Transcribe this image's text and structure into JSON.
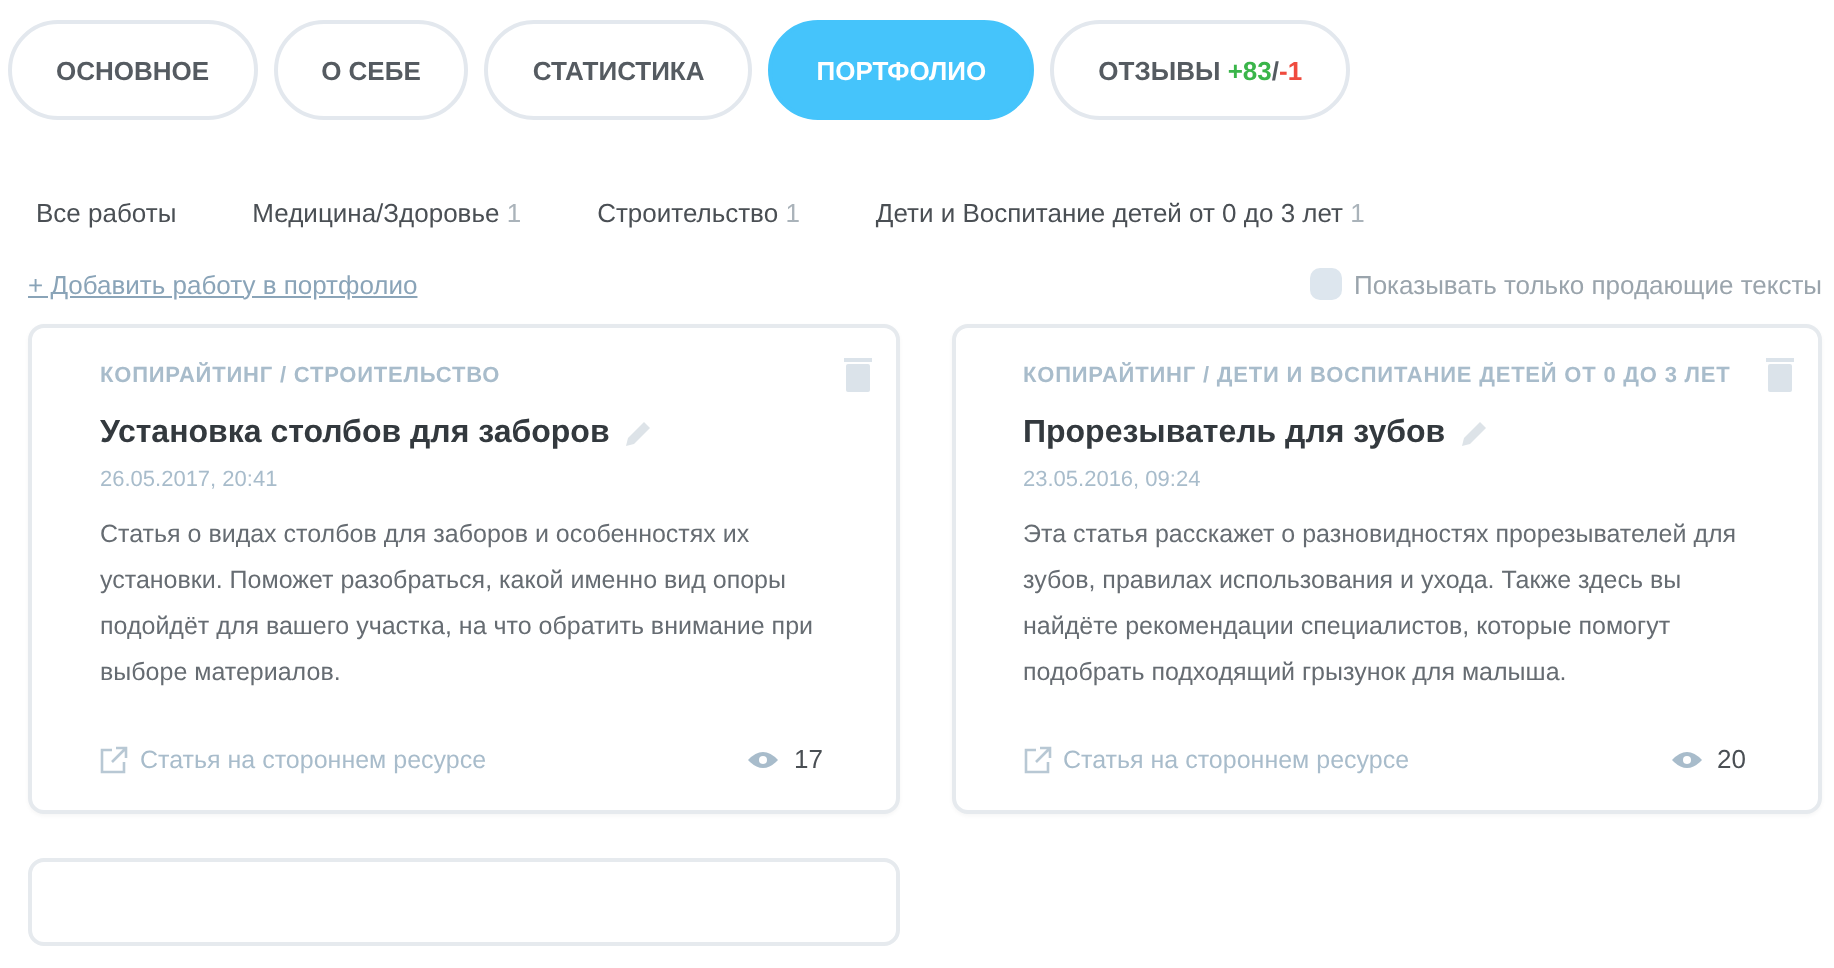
{
  "tabs": [
    {
      "label": "ОСНОВНОЕ",
      "selected": false
    },
    {
      "label": "О СЕБЕ",
      "selected": false
    },
    {
      "label": "СТАТИСТИКА",
      "selected": false
    },
    {
      "label": "ПОРТФОЛИО",
      "selected": true
    },
    {
      "label": "ОТЗЫВЫ",
      "selected": false,
      "positive": "+83",
      "slash": "/",
      "negative": "-1"
    }
  ],
  "filters": [
    {
      "label": "Все работы"
    },
    {
      "label": "Медицина/Здоровье",
      "count": "1"
    },
    {
      "label": "Строительство",
      "count": "1"
    },
    {
      "label": "Дети и Воспитание детей от 0 до 3 лет",
      "count": "1"
    }
  ],
  "add_link": "+ Добавить работу в портфолио",
  "selling_only": {
    "label": "Показывать только продающие тексты",
    "checked": false
  },
  "cards": [
    {
      "category": "КОПИРАЙТИНГ / СТРОИТЕЛЬСТВО",
      "title": "Установка столбов для заборов",
      "date": "26.05.2017, 20:41",
      "description": "Статья о видах столбов для заборов и особенностях их установки. Поможет разобраться, какой именно вид опоры подойдёт для вашего участка, на что обратить внимание при выборе материалов.",
      "source": "Статья на стороннем ресурсе",
      "views": "17"
    },
    {
      "category": "КОПИРАЙТИНГ / ДЕТИ И ВОСПИТАНИЕ ДЕТЕЙ ОТ 0 ДО 3 ЛЕТ",
      "title": "Прорезыватель для зубов",
      "date": "23.05.2016, 09:24",
      "description": "Эта статья расскажет о разновидностях прорезывателей для зубов, правилах использования и ухода. Также здесь вы найдёте рекомендации специалистов, которые помогут подобрать подходящий грызунок для малыша.",
      "source": "Статья на стороннем ресурсе",
      "views": "20"
    }
  ]
}
